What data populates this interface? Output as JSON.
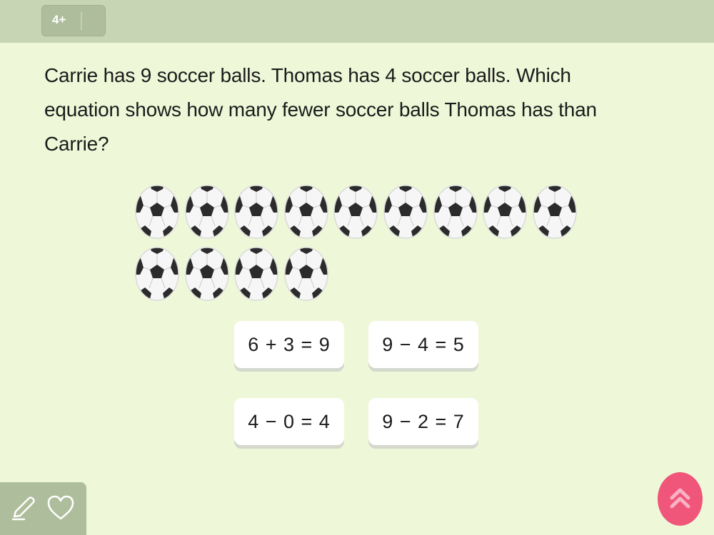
{
  "header": {
    "grade_label": "4+"
  },
  "question": {
    "text": "Carrie has 9 soccer balls. Thomas has 4 soccer balls. Which equation shows how many fewer soccer balls Thomas has than Carrie?"
  },
  "illustration": {
    "icon": "soccer-ball-icon",
    "rows": [
      9,
      4
    ]
  },
  "choices": [
    {
      "label": "6 + 3 = 9"
    },
    {
      "label": "9 − 4 = 5"
    },
    {
      "label": "4 − 0 = 4"
    },
    {
      "label": "9 − 2 = 7"
    }
  ],
  "toolbar": {
    "icons": [
      "pencil-icon",
      "heart-icon"
    ]
  },
  "fab": {
    "icon": "double-chevron-up-icon"
  },
  "colors": {
    "background": "#eef8d8",
    "topbar": "#c8d5b4",
    "chip": "#aebd9b",
    "accent": "#f0557a"
  }
}
